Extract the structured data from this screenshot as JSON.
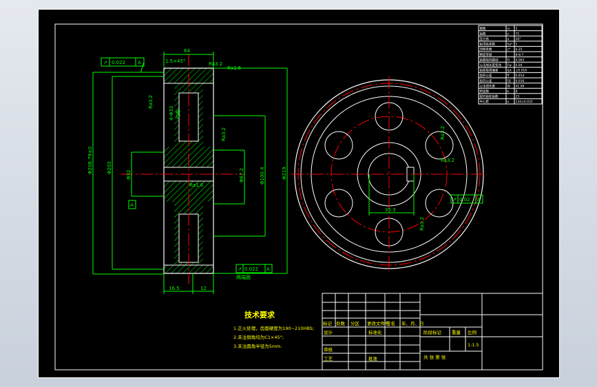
{
  "colors": {
    "background": "#000000",
    "outline": "#ffffff",
    "dimension": "#00ff00",
    "center_line": "#ff0000",
    "text_yellow": "#ffff00",
    "hatch": "#00ff00"
  },
  "section_view": {
    "top_width_dim": "64",
    "chamfer_note": "1.5×45°",
    "roughness_top_right": "Ra1.6",
    "roughness_top": "Ra3.2",
    "geometric_tolerance_left": "0.022",
    "datum_left": "A",
    "outer_dim_left": "Φ208.79±0",
    "outer_dim_2": "Φ203",
    "web_note": "Ra3.2",
    "hole_dim": "4-Φ32",
    "hole_note": "均布",
    "bore_dim": "Φ32",
    "hub_dim": "Φ67.2",
    "hub_outer_dim": "Φ100.4",
    "outer_dim_right": "Φ219",
    "roughness_bore": "Ra1.6",
    "roughness_mid": "Ra3.2",
    "geometric_tolerance_bottom": "0.022",
    "datum_bottom": "A",
    "datum_tag": "A",
    "bottom_dim_left": "16.5",
    "bottom_dim_right": "12",
    "bottom_note": "两端面"
  },
  "front_view": {
    "keyway_dim": "35.3",
    "roughness_hole": "Ra3.2",
    "roughness_key": "Ra3.2",
    "roughness_side": "Ra3.2",
    "tolerance_value": "0.02",
    "tolerance_datum": "A"
  },
  "technical_requirements": {
    "title": "技术要求",
    "items": [
      "1.正火处理，齿面硬度为190~210HBS;",
      "2.未注倒角均为C1×45°;",
      "3.未注圆角半径为5mm."
    ]
  },
  "parameter_table": {
    "rows": [
      [
        "模数",
        "m",
        "3"
      ],
      [
        "齿数",
        "z",
        "71"
      ],
      [
        "压力角",
        "α",
        "20°"
      ],
      [
        "齿顶高系数",
        "ha*",
        "1"
      ],
      [
        "顶隙系数",
        "c*",
        "0.25"
      ],
      [
        "精度等级",
        "",
        "8-8-7"
      ],
      [
        "齿圈径向跳动",
        "Fr",
        "0.063"
      ],
      [
        "公法线长度变动",
        "Fw",
        "0.04"
      ],
      [
        "齿距极限偏差",
        "fpt",
        "±0.016"
      ],
      [
        "齿形公差",
        "ff",
        "0.014"
      ],
      [
        "齿向公差",
        "Fβ",
        "0.016"
      ],
      [
        "公法线长度",
        "W",
        "41.99"
      ],
      [
        "跨齿数",
        "k",
        "8"
      ],
      [
        "配对齿轮齿数",
        "",
        "23"
      ],
      [
        "中心距",
        "a",
        "144±0.032"
      ]
    ]
  },
  "title_block": {
    "header_cells": [
      "标记",
      "处数",
      "分区",
      "更改文件号",
      "签名",
      "年、月、日"
    ],
    "design_label": "设计",
    "standard_label": "标准化",
    "review_label": "审核",
    "process_label": "工艺",
    "approve_label": "批准",
    "stage_label": "阶段标记",
    "weight_label": "重量",
    "scale_label": "比例",
    "scale_value": "1:1.5",
    "sheet_text": "共   张   第   张"
  }
}
